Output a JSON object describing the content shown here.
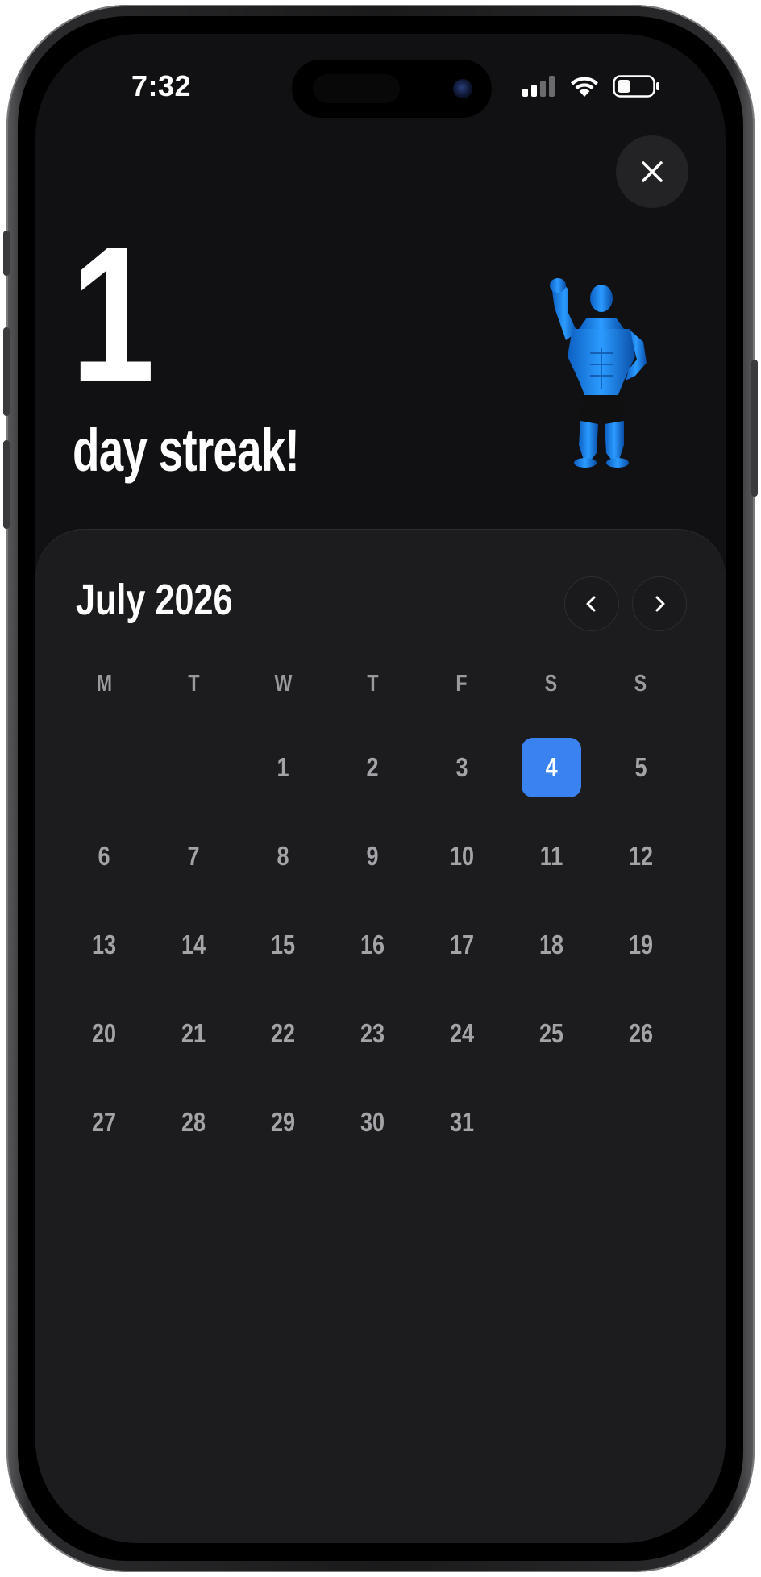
{
  "status_bar": {
    "time": "7:32"
  },
  "streak": {
    "count": "1",
    "label": "day streak!"
  },
  "colors": {
    "screen_bg": "#111113",
    "sheet_bg": "#1c1c1e",
    "accent": "#3a82f0",
    "day_text": "#a3a3a8",
    "mascot": "#1e88e5"
  },
  "icons": {
    "close": "close-icon",
    "prev": "chevron-left-icon",
    "next": "chevron-right-icon",
    "signal": "cellular-signal-icon",
    "wifi": "wifi-icon",
    "battery": "battery-icon",
    "mascot": "muscleman-mascot-icon"
  },
  "calendar": {
    "month_title": "July 2026",
    "weekdays": [
      "M",
      "T",
      "W",
      "T",
      "F",
      "S",
      "S"
    ],
    "leading_blanks": 2,
    "days": [
      "1",
      "2",
      "3",
      "4",
      "5",
      "6",
      "7",
      "8",
      "9",
      "10",
      "11",
      "12",
      "13",
      "14",
      "15",
      "16",
      "17",
      "18",
      "19",
      "20",
      "21",
      "22",
      "23",
      "24",
      "25",
      "26",
      "27",
      "28",
      "29",
      "30",
      "31"
    ],
    "selected_day": "4"
  }
}
